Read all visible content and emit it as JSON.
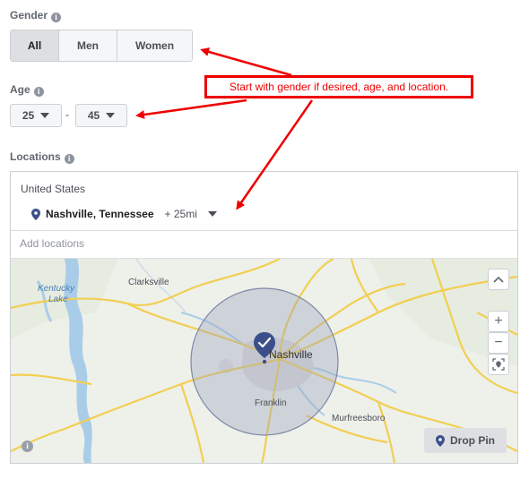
{
  "gender": {
    "label": "Gender",
    "options": [
      "All",
      "Men",
      "Women"
    ],
    "selected": "All"
  },
  "age": {
    "label": "Age",
    "min": "25",
    "separator": "-",
    "max": "45"
  },
  "locations": {
    "label": "Locations",
    "country": "United States",
    "city": "Nashville, Tennessee",
    "radius": "+ 25mi",
    "add_placeholder": "Add locations"
  },
  "map": {
    "labels": {
      "kentucky": "Kentucky",
      "lake": "Lake",
      "clarksville": "Clarksville",
      "nashville": "Nashville",
      "franklin": "Franklin",
      "murfreesboro": "Murfreesboro"
    },
    "zoom_in": "+",
    "zoom_out": "−",
    "drop_pin": "Drop Pin",
    "radius_fill": "#9aa3bd",
    "pin_color": "#3b4f8a"
  },
  "annotation": {
    "text": "Start with gender if desired, age, and location.",
    "color": "#ee0000"
  },
  "icons": [
    "info-icon",
    "caret-down-icon",
    "location-pin-icon",
    "chevron-up-icon",
    "locate-icon",
    "drop-pin-icon",
    "annotation-arrow-icon"
  ]
}
